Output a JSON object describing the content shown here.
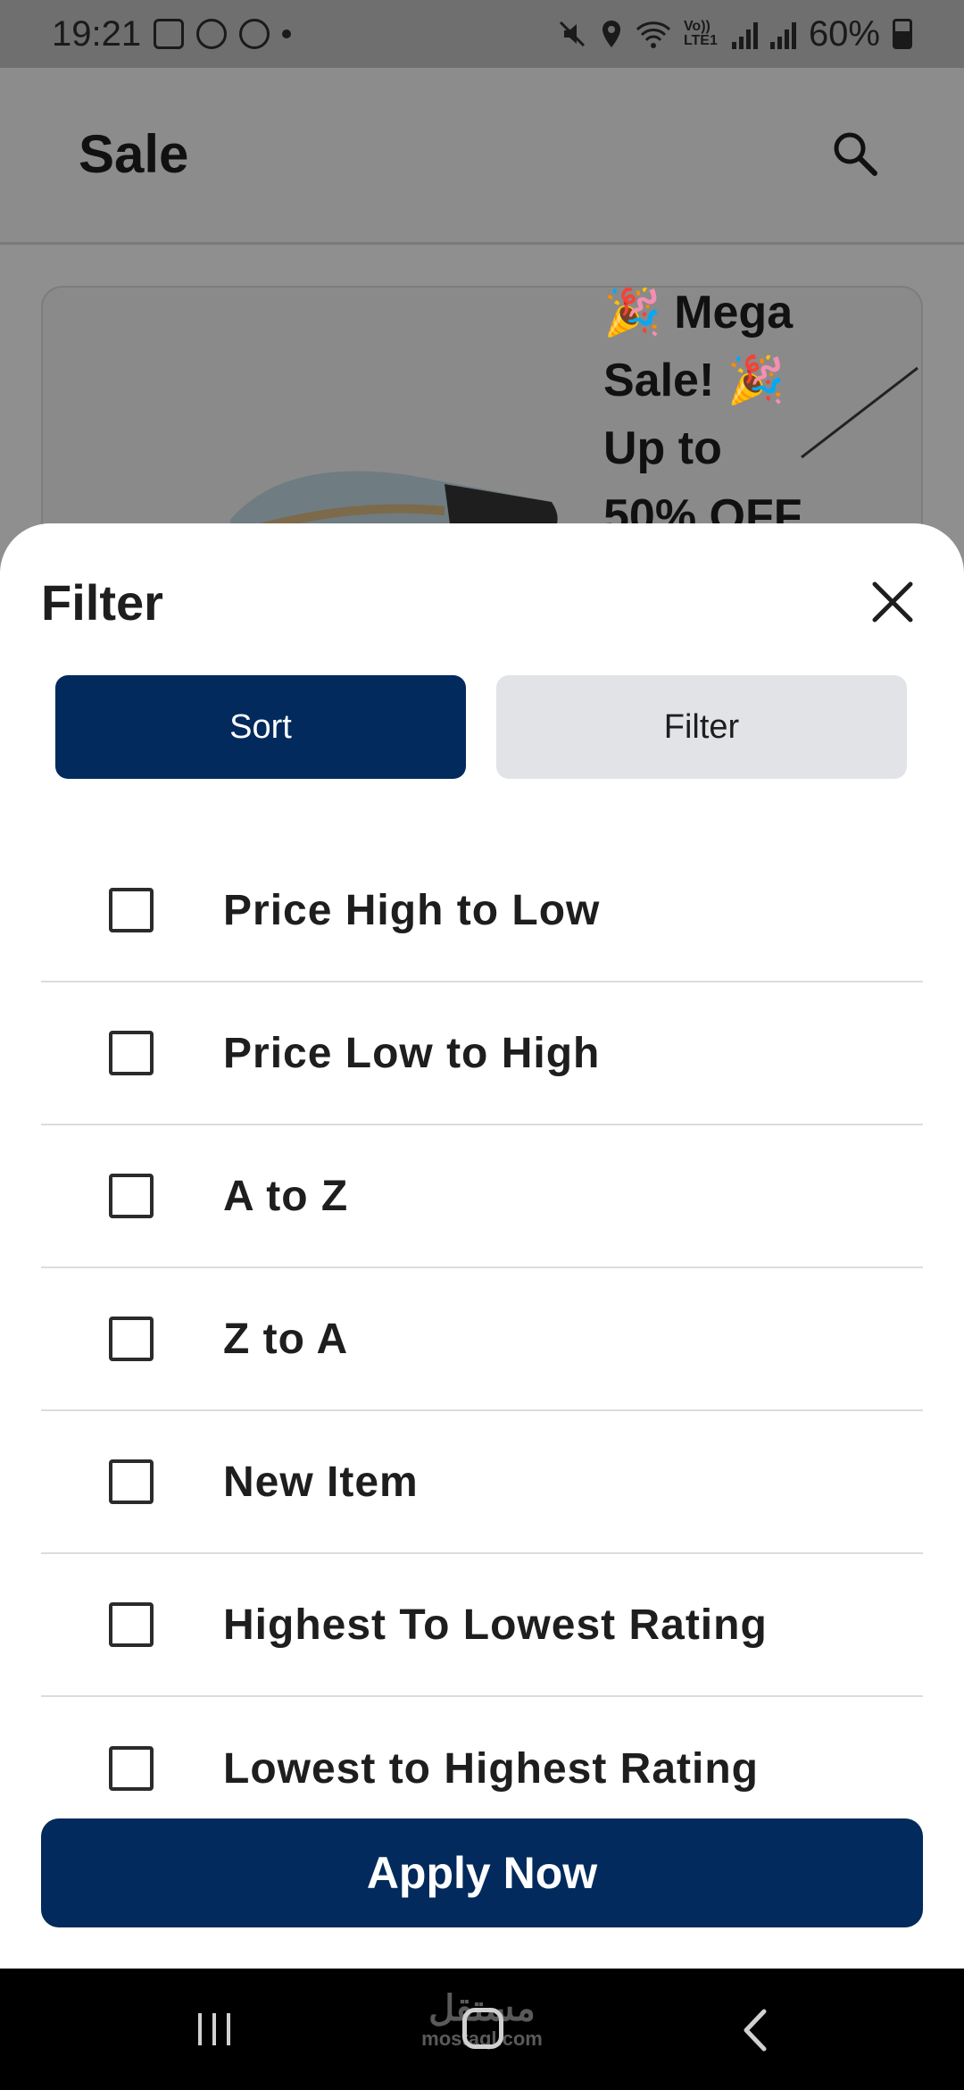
{
  "status_bar": {
    "time": "19:21",
    "battery": "60%",
    "network_label": "Vo)) LTE1"
  },
  "header": {
    "title": "Sale"
  },
  "banner": {
    "text": "🎉 Mega Sale! 🎉 Up to 50% OFF"
  },
  "sheet": {
    "title": "Filter",
    "tabs": {
      "sort": "Sort",
      "filter": "Filter"
    },
    "options": [
      {
        "label": "Price High to Low",
        "checked": false
      },
      {
        "label": "Price Low to High",
        "checked": false
      },
      {
        "label": "A to Z",
        "checked": false
      },
      {
        "label": "Z to A",
        "checked": false
      },
      {
        "label": "New Item",
        "checked": false
      },
      {
        "label": "Highest To Lowest Rating",
        "checked": false
      },
      {
        "label": "Lowest to Highest Rating",
        "checked": false
      }
    ],
    "apply_label": "Apply Now"
  },
  "watermark": {
    "arabic": "مستقل",
    "latin": "mostaql.com"
  },
  "colors": {
    "primary": "#022a5c",
    "tab_inactive": "#e1e3e7",
    "overlay": "#8f8f8f"
  }
}
